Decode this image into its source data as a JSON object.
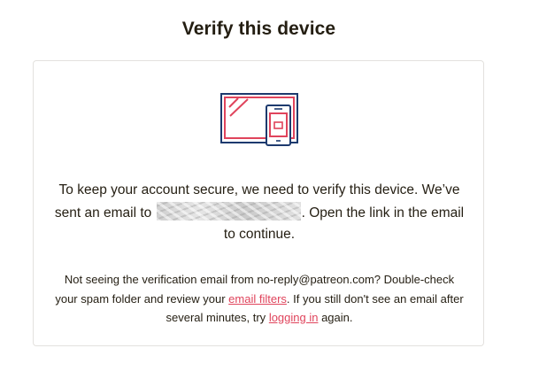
{
  "page": {
    "title": "Verify this device"
  },
  "main_message": {
    "line_part1": "To keep your account secure, we need to verify this device. We’ve sent an email to",
    "line_part2": ". Open the link in the email to continue."
  },
  "help_message": {
    "part1": "Not seeing the verification email from no-reply@patreon.com? Double-check your spam folder and review your ",
    "email_filters_link": "email filters",
    "part2": ". If you still don't see an email after several minutes, try ",
    "logging_in_link": "logging in",
    "part3": " again."
  },
  "icons": {
    "illustration": "laptop-and-phone-icon"
  },
  "colors": {
    "navy": "#1d3a6e",
    "accent": "#e0445c",
    "text": "#241e12"
  }
}
